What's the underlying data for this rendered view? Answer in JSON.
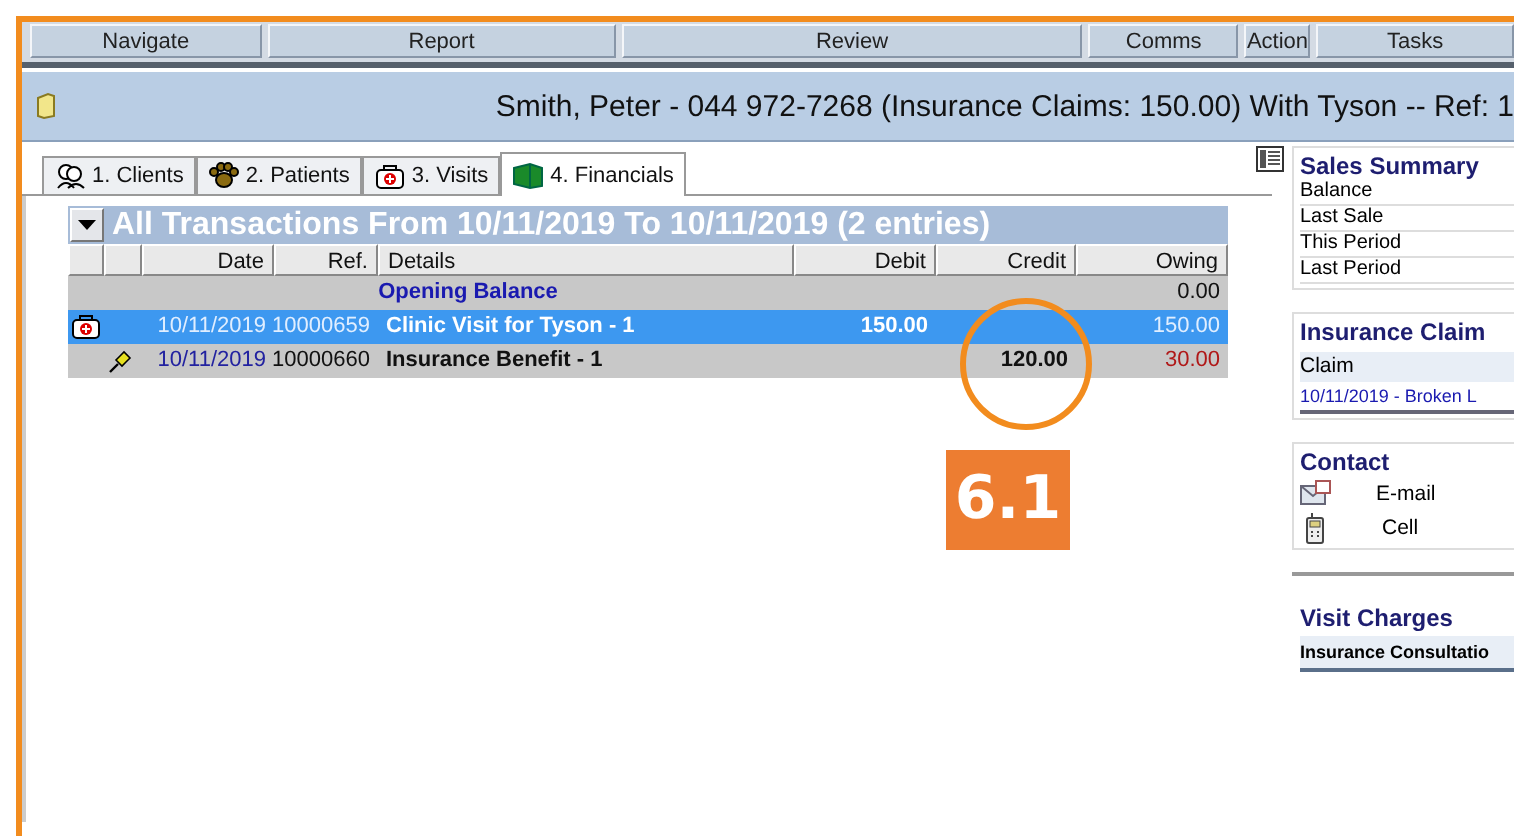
{
  "menu": [
    "Navigate",
    "Report",
    "Review",
    "Comms",
    "Action",
    "Tasks"
  ],
  "window": {
    "title": "Smith, Peter - 044 972-7268 (Insurance Claims: 150.00) With Tyson -- Ref: 1"
  },
  "tabs": [
    {
      "label": "1. Clients",
      "kind": "clients",
      "selected": false
    },
    {
      "label": "2. Patients",
      "kind": "patients",
      "selected": false
    },
    {
      "label": "3. Visits",
      "kind": "visits",
      "selected": false
    },
    {
      "label": "4. Financials",
      "kind": "financials",
      "selected": true
    }
  ],
  "table": {
    "title": "All Transactions From 10/11/2019 To 10/11/2019 (2 entries)",
    "columns": [
      "Date",
      "Ref.",
      "Details",
      "Debit",
      "Credit",
      "Owing"
    ],
    "rows": [
      {
        "kind": "opening",
        "details": "Opening Balance",
        "owing": "0.00",
        "selected": false
      },
      {
        "kind": "visit",
        "date": "10/11/2019",
        "ref": "10000659",
        "details": "Clinic Visit for Tyson - 1",
        "debit": "150.00",
        "owing": "150.00",
        "selected": true
      },
      {
        "kind": "benefit",
        "date": "10/11/2019",
        "ref": "10000660",
        "details": "Insurance Benefit - 1",
        "credit": "120.00",
        "owing": "30.00",
        "selected": false
      }
    ]
  },
  "annotation": {
    "label": "6.1"
  },
  "sales_summary": {
    "title": "Sales Summary",
    "rows": [
      "Balance",
      "Last Sale",
      "This Period",
      "Last Period"
    ]
  },
  "insurance_claims": {
    "title": "Insurance Claim",
    "column": "Claim",
    "rows": [
      "10/11/2019 - Broken L"
    ]
  },
  "contact": {
    "title": "Contact",
    "rows": [
      {
        "kind": "email",
        "label": "E-mail"
      },
      {
        "kind": "cell",
        "label": "Cell"
      }
    ]
  },
  "visit_charges": {
    "title": "Visit Charges",
    "rows": [
      "Insurance Consultatio"
    ]
  }
}
